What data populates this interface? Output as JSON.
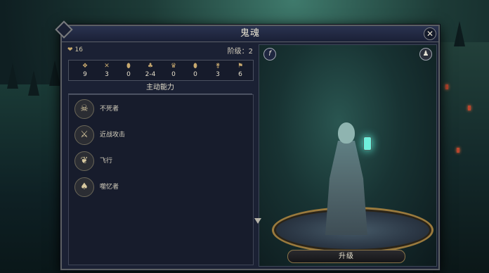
{
  "dialog": {
    "title": "鬼魂",
    "close_label": "✕"
  },
  "unit": {
    "hp": "16",
    "level_text": "阶级：2"
  },
  "stats": [
    {
      "icon": "heart-icon",
      "glyph": "❖",
      "value": "9"
    },
    {
      "icon": "crossed-swords-icon",
      "glyph": "✕",
      "value": "3"
    },
    {
      "icon": "shield-icon",
      "glyph": "⬮",
      "value": "0"
    },
    {
      "icon": "damage-icon",
      "glyph": "♣",
      "value": "2-4"
    },
    {
      "icon": "crown-icon",
      "glyph": "♛",
      "value": "0"
    },
    {
      "icon": "shield2-icon",
      "glyph": "⬮",
      "value": "0"
    },
    {
      "icon": "boot-icon",
      "glyph": "⚵",
      "value": "3"
    },
    {
      "icon": "flag-icon",
      "glyph": "⚑",
      "value": "6"
    }
  ],
  "abilities": {
    "header": "主动能力",
    "items": [
      {
        "icon": "skull-icon",
        "glyph": "☠",
        "label": "不死者"
      },
      {
        "icon": "sword-icon",
        "glyph": "⚔",
        "label": "近战攻击"
      },
      {
        "icon": "wing-icon",
        "glyph": "❦",
        "label": "飞行"
      },
      {
        "icon": "hood-icon",
        "glyph": "♠",
        "label": "噬忆者"
      }
    ]
  },
  "preview": {
    "info_label": "f",
    "person_label": "♟",
    "upgrade_label": "升级"
  },
  "colors": {
    "panel": "#1b2134",
    "accent_gold": "#8a7449",
    "lantern": "#6ff0dc"
  }
}
